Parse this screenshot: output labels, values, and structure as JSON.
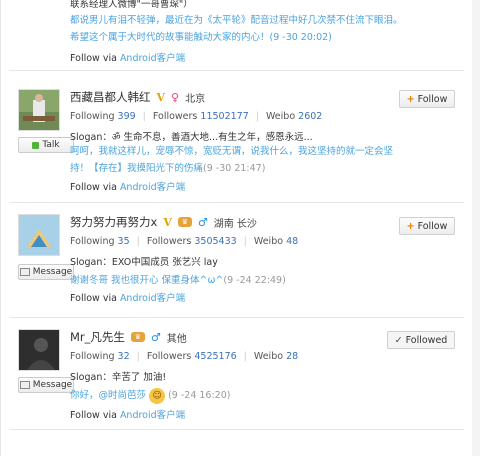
{
  "top_card": {
    "line1": "联系经理人微博\"一哥曹琛\"）",
    "line2": "都说男儿有泪不轻弹，最近在为《太平轮》配音过程中好几次禁不住流下眼泪。",
    "line3": "希望这个属于大时代的故事能触动大家的内心！(9 -30 20:02)",
    "via_prefix": "Follow via",
    "via_link": "Android客户端"
  },
  "cards": [
    {
      "name": "西藏昌都人韩红",
      "location": "北京",
      "following_label": "Following",
      "following": "399",
      "followers_label": "Followers",
      "followers": "11502177",
      "weibo_label": "Weibo",
      "weibo": "2602",
      "slogan": "Slogan：ॐ 生命不息，善酒大地...有生之年，感恩永远...",
      "weibo_text": "呵呵，我就这样儿，宠辱不惊，宽贬无谓，说我什么，我这坚持的就一定会坚持！【存在】我摸阳光下的伤痛",
      "time": "(9 -30 21:47)",
      "via_prefix": "Follow via",
      "via_link": "Android客户端",
      "follow_label": "Follow",
      "side_label": "Talk"
    },
    {
      "name": "努力努力再努力x",
      "location": "湖南 长沙",
      "following_label": "Following",
      "following": "35",
      "followers_label": "Followers",
      "followers": "3505433",
      "weibo_label": "Weibo",
      "weibo": "48",
      "slogan": "Slogan：EXO中国成员 张艺兴 lay",
      "weibo_text": "谢谢冬哥 我也很开心 保重身体^ω^",
      "time": "(9 -24 22:49)",
      "via_prefix": "Follow via",
      "via_link": "Android客户端",
      "follow_label": "Follow",
      "side_label": "Message"
    },
    {
      "name": "Mr_凡先生",
      "location": "其他",
      "following_label": "Following",
      "following": "32",
      "followers_label": "Followers",
      "followers": "4525176",
      "weibo_label": "Weibo",
      "weibo": "28",
      "slogan": "Slogan：辛苦了 加油!",
      "weibo_text": "你好，@时尚芭莎",
      "time": "(9 -24 16:20)",
      "via_prefix": "Follow via",
      "via_link": "Android客户端",
      "follow_label": "Followed",
      "side_label": "Message"
    }
  ]
}
